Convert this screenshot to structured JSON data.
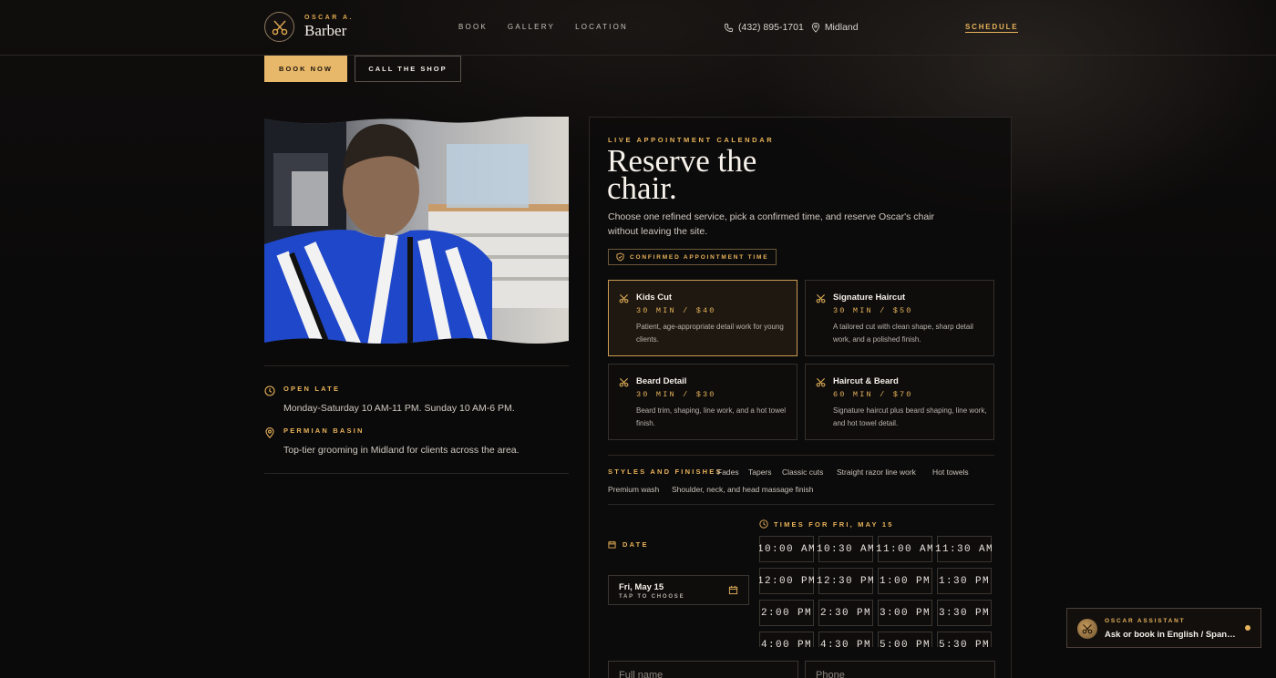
{
  "brand": {
    "small": "OSCAR A.",
    "name": "Barber",
    "accent": "#e8b35a"
  },
  "nav": [
    "BOOK",
    "GALLERY",
    "LOCATION"
  ],
  "contact": {
    "phone": "(432) 895-1701",
    "location": "Midland"
  },
  "header": {
    "schedule": "SCHEDULE"
  },
  "hero": {
    "book_now": "BOOK NOW",
    "call": "CALL THE SHOP"
  },
  "info": [
    {
      "icon": "clock-icon",
      "title": "OPEN LATE",
      "text": "Monday-Saturday 10 AM-11 PM. Sunday 10 AM-6 PM."
    },
    {
      "icon": "map-pin-icon",
      "title": "PERMIAN BASIN",
      "text": "Top-tier grooming in Midland for clients across the area."
    }
  ],
  "booking": {
    "eyebrow": "LIVE APPOINTMENT CALENDAR",
    "title": "Reserve the chair.",
    "description": "Choose one refined service, pick a confirmed time, and reserve Oscar's chair without leaving the site.",
    "badge": "CONFIRMED APPOINTMENT TIME",
    "services": [
      {
        "name": "Kids Cut",
        "meta": "30 MIN / $40",
        "desc": "Patient, age-appropriate detail work for young clients.",
        "selected": true
      },
      {
        "name": "Signature Haircut",
        "meta": "30 MIN / $50",
        "desc": "A tailored cut with clean shape, sharp detail work, and a polished finish.",
        "selected": false
      },
      {
        "name": "Beard Detail",
        "meta": "30 MIN / $30",
        "desc": "Beard trim, shaping, line work, and a hot towel finish.",
        "selected": false
      },
      {
        "name": "Haircut & Beard",
        "meta": "60 MIN / $70",
        "desc": "Signature haircut plus beard shaping, line work, and hot towel detail.",
        "selected": false
      }
    ],
    "styles_label": "STYLES AND FINISHES",
    "styles": [
      "Fades",
      "Tapers",
      "Classic cuts",
      "Straight razor line work",
      "Hot towels",
      "Premium wash",
      "Shoulder, neck, and head massage finish"
    ],
    "date_label": "DATE",
    "date_value": "Fri, May 15",
    "date_hint": "TAP TO CHOOSE",
    "times_label": "TIMES FOR FRI, MAY 15",
    "times": [
      "10:00 AM",
      "10:30 AM",
      "11:00 AM",
      "11:30 AM",
      "12:00 PM",
      "12:30 PM",
      "1:00 PM",
      "1:30 PM",
      "2:00 PM",
      "2:30 PM",
      "3:00 PM",
      "3:30 PM",
      "4:00 PM",
      "4:30 PM",
      "5:00 PM",
      "5:30 PM"
    ],
    "fields": {
      "name_placeholder": "Full name",
      "phone_placeholder": "Phone"
    }
  },
  "assistant": {
    "title": "OSCAR ASSISTANT",
    "text": "Ask or book in English / Spanish"
  }
}
